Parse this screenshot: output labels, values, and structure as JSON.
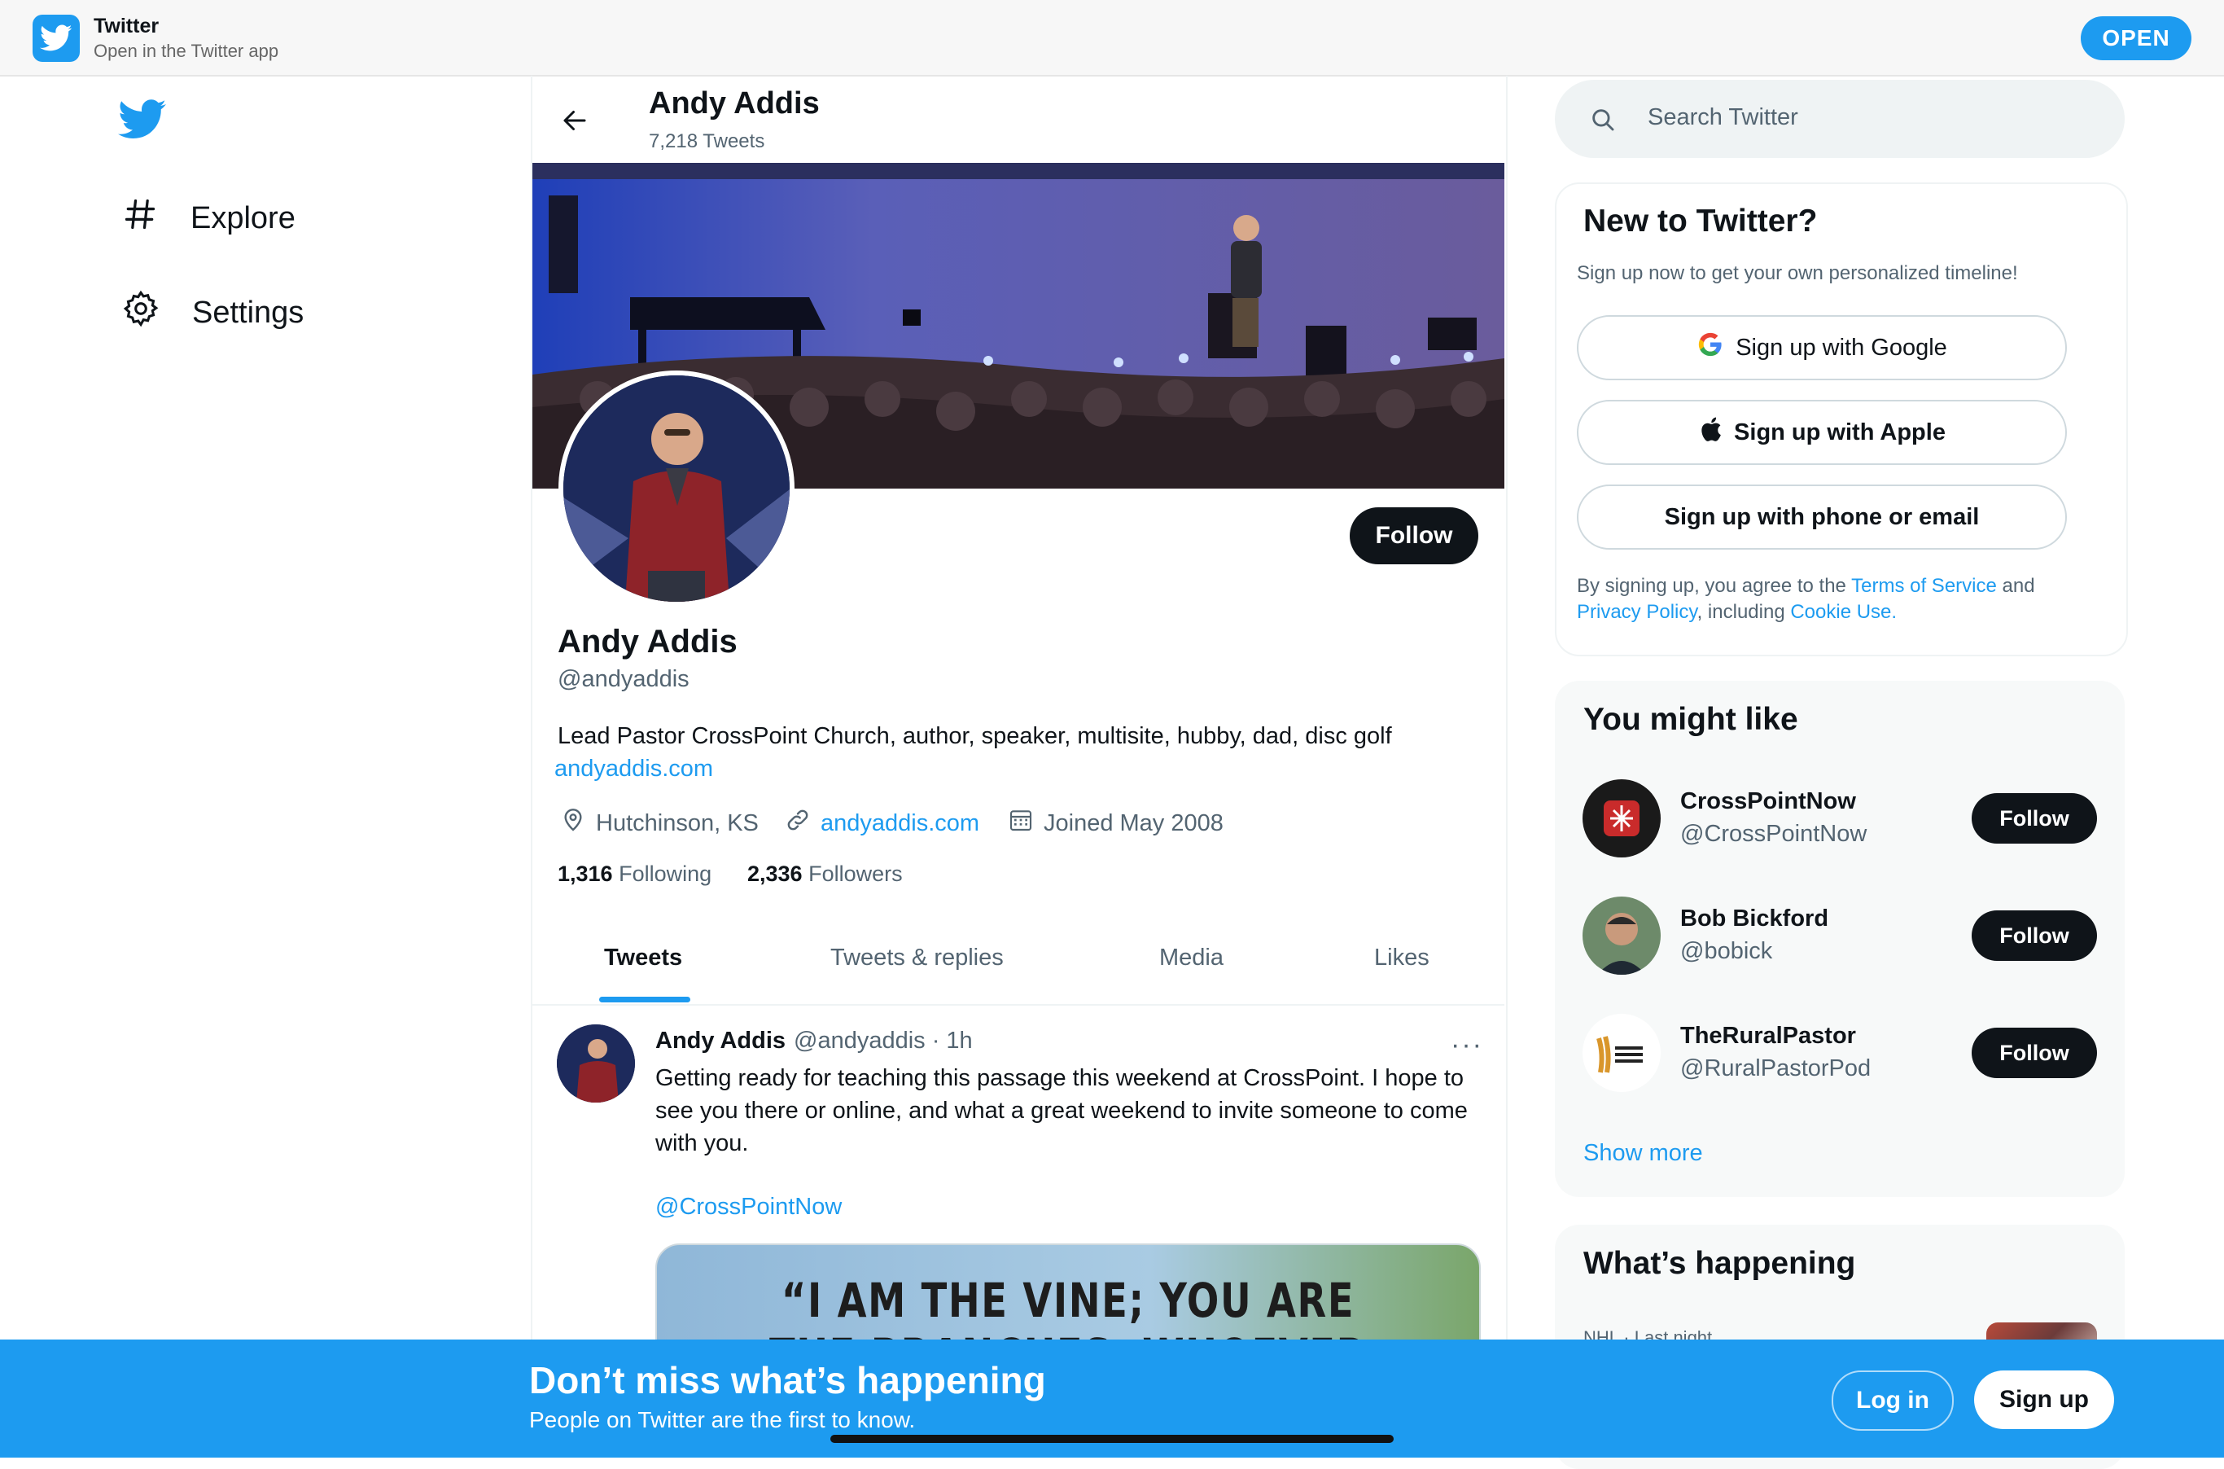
{
  "app_banner": {
    "title": "Twitter",
    "subtitle": "Open in the Twitter app",
    "open_label": "OPEN"
  },
  "nav": {
    "items": [
      {
        "label": "Explore",
        "icon": "hashtag-icon"
      },
      {
        "label": "Settings",
        "icon": "gear-icon"
      }
    ]
  },
  "header": {
    "name": "Andy Addis",
    "tweet_count": "7,218 Tweets"
  },
  "profile": {
    "follow_label": "Follow",
    "name": "Andy Addis",
    "handle": "@andyaddis",
    "bio": "Lead Pastor CrossPoint Church, author, speaker, multisite, hubby, dad, disc golf",
    "bio_link": "andyaddis.com",
    "location": "Hutchinson, KS",
    "website": "andyaddis.com",
    "joined": "Joined May 2008",
    "following_count": "1,316",
    "following_label": "Following",
    "followers_count": "2,336",
    "followers_label": "Followers"
  },
  "tabs": [
    "Tweets",
    "Tweets & replies",
    "Media",
    "Likes"
  ],
  "tweet": {
    "author": "Andy Addis",
    "handle_time": "@andyaddis · 1h",
    "more": "···",
    "text": "Getting ready for teaching this passage this weekend at CrossPoint. I hope to see you there or online, and what a great weekend to invite someone to come with you.",
    "mention": "@CrossPointNow",
    "media_text": "“I AM THE VINE; YOU ARE THE BRANCHES. WHOEVER ABIDES IN"
  },
  "search": {
    "placeholder": "Search Twitter"
  },
  "new_to_twitter": {
    "title": "New to Twitter?",
    "subtitle": "Sign up now to get your own personalized timeline!",
    "google": "Sign up with Google",
    "apple": "Sign up with Apple",
    "phone": "Sign up with phone or email",
    "terms_prefix": "By signing up, you agree to the ",
    "terms_link": "Terms of Service",
    "terms_and": " and ",
    "privacy_link": "Privacy Policy",
    "terms_including": ", including ",
    "cookie_link": "Cookie Use."
  },
  "you_might_like": {
    "title": "You might like",
    "suggestions": [
      {
        "name": "CrossPointNow",
        "handle": "@CrossPointNow",
        "follow": "Follow"
      },
      {
        "name": "Bob Bickford",
        "handle": "@bobick",
        "follow": "Follow"
      },
      {
        "name": "TheRuralPastor",
        "handle": "@RuralPastorPod",
        "follow": "Follow"
      }
    ],
    "show_more": "Show more"
  },
  "whats_happening": {
    "title": "What’s happening",
    "peek": "NHL · Last night"
  },
  "bottom_bar": {
    "title": "Don’t miss what’s happening",
    "subtitle": "People on Twitter are the first to know.",
    "login": "Log in",
    "signup": "Sign up"
  },
  "colors": {
    "accent": "#1d9bf0",
    "text": "#0f1419",
    "muted": "#536471"
  }
}
